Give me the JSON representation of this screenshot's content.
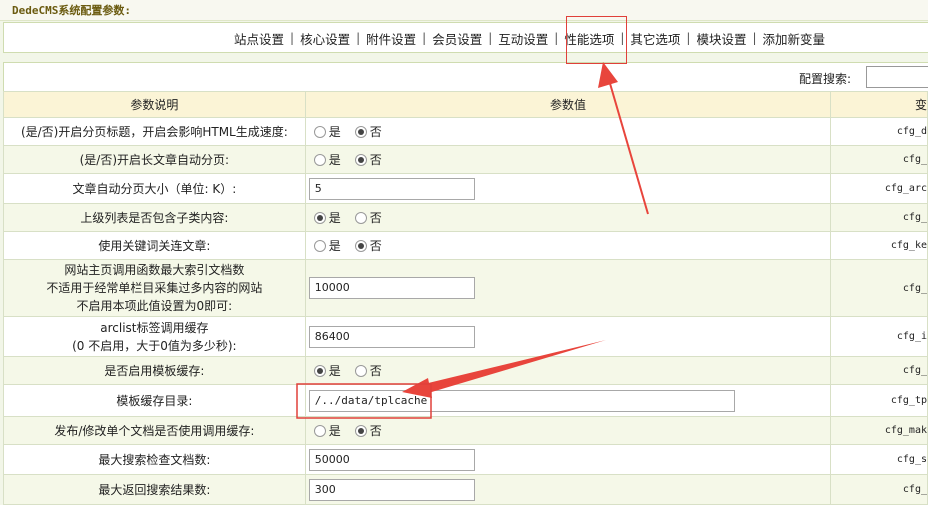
{
  "header": {
    "title": "DedeCMS系统配置参数:"
  },
  "tabs": [
    "站点设置",
    "核心设置",
    "附件设置",
    "会员设置",
    "互动设置",
    "性能选项",
    "其它选项",
    "模块设置",
    "添加新变量"
  ],
  "search": {
    "label": "配置搜索:"
  },
  "table": {
    "headers": [
      "参数说明",
      "参数值",
      "变"
    ],
    "radio_yes": "是",
    "radio_no": "否",
    "rows": [
      {
        "desc": "(是/否)开启分页标题，开启会影响HTML生成速度:",
        "selected": "no",
        "var": "cfg_d"
      },
      {
        "desc": "(是/否)开启长文章自动分页:",
        "selected": "no",
        "var": "cfg_"
      },
      {
        "desc": "文章自动分页大小（单位: K）:",
        "value": "5",
        "var": "cfg_arc"
      },
      {
        "desc": "上级列表是否包含子类内容:",
        "selected": "yes",
        "var": "cfg_"
      },
      {
        "desc": "使用关键词关连文章:",
        "selected": "no",
        "var": "cfg_ke"
      },
      {
        "desc_lines": [
          "网站主页调用函数最大索引文档数",
          "不适用于经常单栏目采集过多内容的网站",
          "不启用本项此值设置为0即可:"
        ],
        "value": "10000",
        "var": "cfg_"
      },
      {
        "desc_lines": [
          "arclist标签调用缓存",
          "(0 不启用，大于0值为多少秒):"
        ],
        "value": "86400",
        "var": "cfg_i"
      },
      {
        "desc": "是否启用模板缓存:",
        "selected": "yes",
        "var": "cfg_"
      },
      {
        "desc": "模板缓存目录:",
        "value": "/../data/tplcache",
        "var": "cfg_tp"
      },
      {
        "desc": "发布/修改单个文档是否使用调用缓存:",
        "selected": "no",
        "var": "cfg_mak"
      },
      {
        "desc": "最大搜索检查文档数:",
        "value": "50000",
        "var": "cfg_s"
      },
      {
        "desc": "最大返回搜索结果数:",
        "value": "300",
        "var": "cfg_"
      }
    ]
  }
}
